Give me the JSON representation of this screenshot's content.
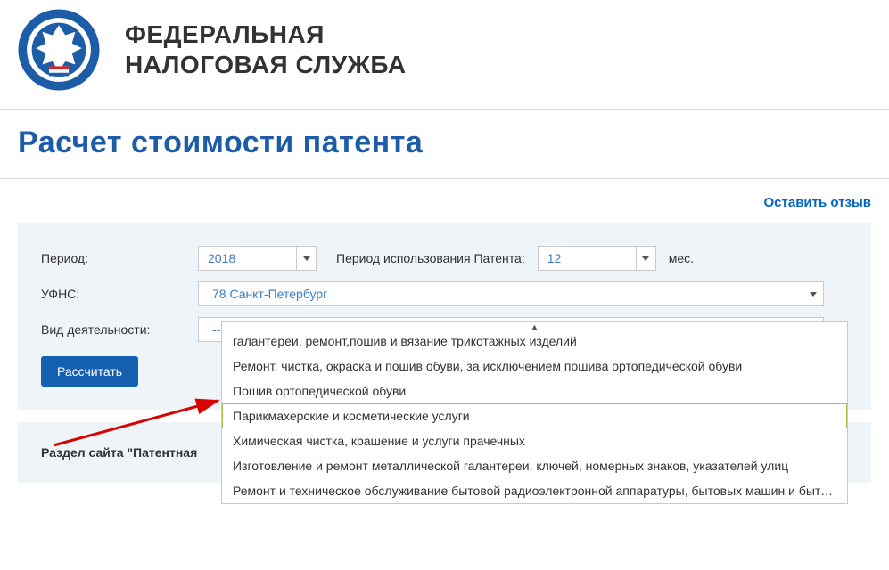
{
  "header": {
    "org_line1": "ФЕДЕРАЛЬНАЯ",
    "org_line2": "НАЛОГОВАЯ СЛУЖБА"
  },
  "page_title": "Расчет стоимости патента",
  "feedback_link": "Оставить отзыв",
  "form": {
    "period_label": "Период:",
    "period_value": "2018",
    "usage_label": "Период использования Патента:",
    "usage_value": "12",
    "usage_suffix": "мес.",
    "region_label": "УФНС:",
    "region_value": "78 Санкт-Петербург",
    "activity_label": "Вид деятельности:",
    "activity_value": "--Выберите--",
    "calc_button": "Рассчитать"
  },
  "section_text": "Раздел сайта \"Патентная",
  "dropdown_options": [
    "галантереи, ремонт,пошив и вязание трикотажных изделий",
    "Ремонт, чистка, окраска и пошив обуви, за исключением пошива ортопедической обуви",
    "Пошив ортопедической обуви",
    "Парикмахерские и косметические услуги",
    "Химическая чистка, крашение и услуги прачечных",
    "Изготовление и ремонт металлической галантереи, ключей, номерных знаков, указателей улиц",
    "Ремонт и техническое обслуживание бытовой радиоэлектронной аппаратуры, бытовых машин и бытовых"
  ],
  "highlighted_index": 3
}
